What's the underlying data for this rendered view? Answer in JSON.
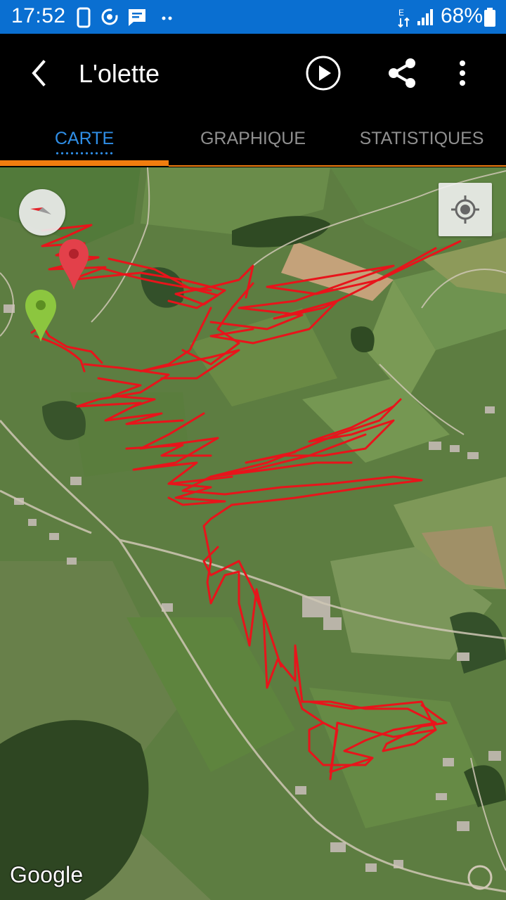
{
  "status_bar": {
    "time": "17:52",
    "battery": "68%",
    "background_color": "#0a6fd1",
    "icons": [
      "phone-icon",
      "sync-icon",
      "message-icon",
      "more-notifications-icon",
      "data-transfer-icon",
      "signal-icon",
      "battery-icon"
    ]
  },
  "app_bar": {
    "title": "L'olette",
    "back_icon": "arrow-back-icon",
    "actions": [
      "play-icon",
      "share-icon",
      "more-vert-icon"
    ]
  },
  "tabs": [
    {
      "label": "CARTE",
      "active": true
    },
    {
      "label": "GRAPHIQUE",
      "active": false
    },
    {
      "label": "STATISTIQUES",
      "active": false
    }
  ],
  "accent_colors": {
    "active_tab": "#2f8ee6",
    "indicator": "#f07d0f",
    "track": "#e8141b"
  },
  "map": {
    "type": "satellite",
    "attribution": "Google",
    "markers": [
      {
        "name": "start",
        "color": "#8cc63f"
      },
      {
        "name": "end",
        "color": "#e3404a"
      }
    ],
    "controls": [
      "compass-icon",
      "my-location-icon"
    ]
  }
}
